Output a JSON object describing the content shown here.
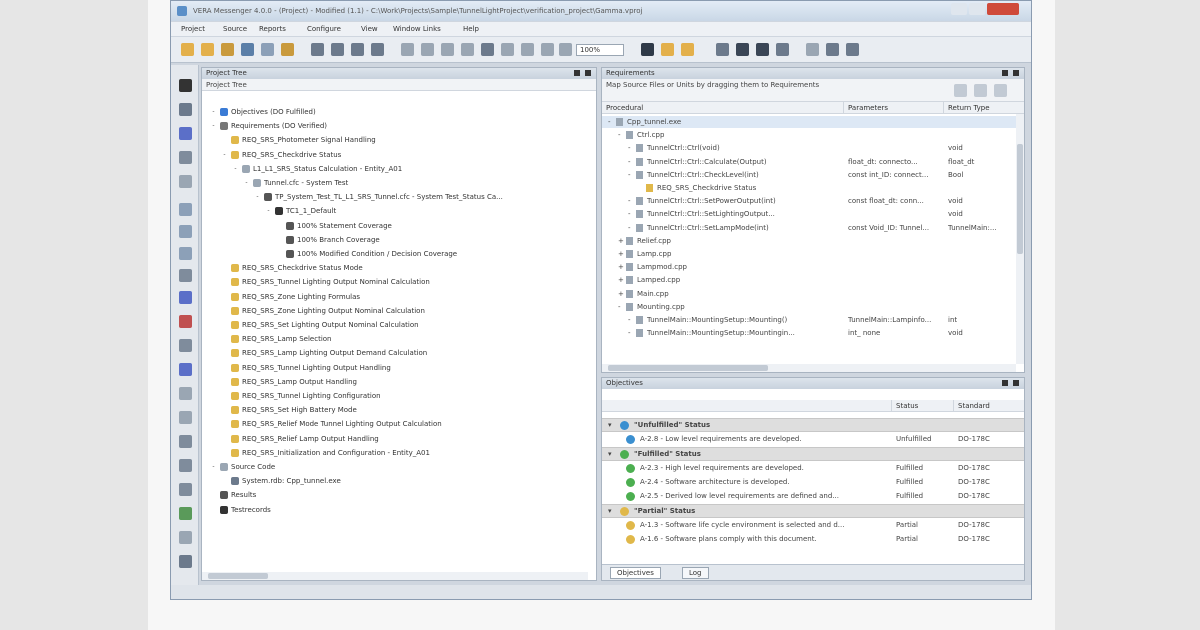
{
  "window": {
    "title": "VERA Messenger 4.0.0 - (Project) - Modified (1.1) - C:\\Work\\Projects\\Sample\\TunnelLightProject\\verification_project\\Gamma.vproj"
  },
  "menu": [
    "Project",
    "Source",
    "Reports",
    "Configure",
    "View",
    "Window Links",
    "Help"
  ],
  "toolbar": {
    "zoom_value": "100%"
  },
  "project_tree": {
    "header": "Project Tree",
    "subheader": "Project Tree",
    "rows": [
      {
        "label": "Objectives (DO Fulfilled)",
        "depth": 1,
        "toggle": "-",
        "icon": "#3a7bd5"
      },
      {
        "label": "Requirements (DO Verified)",
        "depth": 1,
        "toggle": "-",
        "icon": "#777777"
      },
      {
        "label": "REQ_SRS_Photometer Signal Handling",
        "depth": 2,
        "toggle": "",
        "icon": "#e0b84a"
      },
      {
        "label": "REQ_SRS_Checkdrive Status",
        "depth": 2,
        "toggle": "-",
        "icon": "#e0b84a"
      },
      {
        "label": "L1_L1_SRS_Status Calculation - Entity_A01",
        "depth": 3,
        "toggle": "-",
        "icon": "#9aa6b3"
      },
      {
        "label": "Tunnel.cfc - System Test",
        "depth": 4,
        "toggle": "-",
        "icon": "#9aa6b3"
      },
      {
        "label": "TP_System_Test_TL_L1_SRS_Tunnel.cfc - System Test_Status Ca...",
        "depth": 5,
        "toggle": "-",
        "icon": "#555555"
      },
      {
        "label": "TC1_1_Default",
        "depth": 6,
        "toggle": "-",
        "icon": "#333333"
      },
      {
        "label": "100% Statement Coverage",
        "depth": 7,
        "toggle": "",
        "icon": "#555555"
      },
      {
        "label": "100% Branch Coverage",
        "depth": 7,
        "toggle": "",
        "icon": "#555555"
      },
      {
        "label": "100% Modified Condition / Decision Coverage",
        "depth": 7,
        "toggle": "",
        "icon": "#555555"
      },
      {
        "label": "REQ_SRS_Checkdrive Status Mode",
        "depth": 2,
        "toggle": "",
        "icon": "#e0b84a"
      },
      {
        "label": "REQ_SRS_Tunnel Lighting Output Nominal Calculation",
        "depth": 2,
        "toggle": "",
        "icon": "#e0b84a"
      },
      {
        "label": "REQ_SRS_Zone Lighting Formulas",
        "depth": 2,
        "toggle": "",
        "icon": "#e0b84a"
      },
      {
        "label": "REQ_SRS_Zone Lighting Output Nominal Calculation",
        "depth": 2,
        "toggle": "",
        "icon": "#e0b84a"
      },
      {
        "label": "REQ_SRS_Set Lighting Output Nominal Calculation",
        "depth": 2,
        "toggle": "",
        "icon": "#e0b84a"
      },
      {
        "label": "REQ_SRS_Lamp Selection",
        "depth": 2,
        "toggle": "",
        "icon": "#e0b84a"
      },
      {
        "label": "REQ_SRS_Lamp Lighting Output Demand Calculation",
        "depth": 2,
        "toggle": "",
        "icon": "#e0b84a"
      },
      {
        "label": "REQ_SRS_Tunnel Lighting Output Handling",
        "depth": 2,
        "toggle": "",
        "icon": "#e0b84a"
      },
      {
        "label": "REQ_SRS_Lamp Output Handling",
        "depth": 2,
        "toggle": "",
        "icon": "#e0b84a"
      },
      {
        "label": "REQ_SRS_Tunnel Lighting Configuration",
        "depth": 2,
        "toggle": "",
        "icon": "#e0b84a"
      },
      {
        "label": "REQ_SRS_Set High Battery Mode",
        "depth": 2,
        "toggle": "",
        "icon": "#e0b84a"
      },
      {
        "label": "REQ_SRS_Relief Mode Tunnel Lighting Output Calculation",
        "depth": 2,
        "toggle": "",
        "icon": "#e0b84a"
      },
      {
        "label": "REQ_SRS_Relief Lamp Output Handling",
        "depth": 2,
        "toggle": "",
        "icon": "#e0b84a"
      },
      {
        "label": "REQ_SRS_Initialization and Configuration - Entity_A01",
        "depth": 2,
        "toggle": "",
        "icon": "#e0b84a"
      },
      {
        "label": "Source Code",
        "depth": 1,
        "toggle": "-",
        "icon": "#9aa6b3"
      },
      {
        "label": "System.rdb: Cpp_tunnel.exe",
        "depth": 2,
        "toggle": "",
        "icon": "#6c7a8c"
      },
      {
        "label": "Results",
        "depth": 1,
        "toggle": "",
        "icon": "#555555"
      },
      {
        "label": "Testrecords",
        "depth": 1,
        "toggle": "",
        "icon": "#333333"
      }
    ]
  },
  "requirements_panel": {
    "header": "Requirements",
    "hint": "Map Source Files or Units by dragging them to Requirements",
    "columns": [
      "Procedural",
      "Parameters",
      "Return Type"
    ],
    "rows": [
      {
        "depth": 0,
        "toggle": "-",
        "name": "Cpp_tunnel.exe",
        "params": "",
        "ret": ""
      },
      {
        "depth": 1,
        "toggle": "-",
        "name": "Ctrl.cpp",
        "params": "",
        "ret": ""
      },
      {
        "depth": 2,
        "toggle": "-",
        "name": "TunnelCtrl::Ctrl(void)",
        "params": "",
        "ret": "void"
      },
      {
        "depth": 2,
        "toggle": "-",
        "name": "TunnelCtrl::Ctrl::Calculate(Output)",
        "params": "float_dt: connecto...",
        "ret": "float_dt"
      },
      {
        "depth": 2,
        "toggle": "-",
        "name": "TunnelCtrl::Ctrl::CheckLevel(int)",
        "params": "const int_ID: connect...",
        "ret": "Bool"
      },
      {
        "depth": 3,
        "toggle": "",
        "name": "REQ_SRS_Checkdrive Status",
        "params": "",
        "ret": ""
      },
      {
        "depth": 2,
        "toggle": "-",
        "name": "TunnelCtrl::Ctrl::SetPowerOutput(int)",
        "params": "const float_dt: conn...",
        "ret": "void"
      },
      {
        "depth": 2,
        "toggle": "-",
        "name": "TunnelCtrl::Ctrl::SetLightingOutput...",
        "params": "",
        "ret": "void"
      },
      {
        "depth": 2,
        "toggle": "-",
        "name": "TunnelCtrl::Ctrl::SetLampMode(int)",
        "params": "const Void_ID: Tunnel...",
        "ret": "TunnelMain:..."
      },
      {
        "depth": 1,
        "toggle": "+",
        "name": "Relief.cpp",
        "params": "",
        "ret": ""
      },
      {
        "depth": 1,
        "toggle": "+",
        "name": "Lamp.cpp",
        "params": "",
        "ret": ""
      },
      {
        "depth": 1,
        "toggle": "+",
        "name": "Lampmod.cpp",
        "params": "",
        "ret": ""
      },
      {
        "depth": 1,
        "toggle": "+",
        "name": "Lamped.cpp",
        "params": "",
        "ret": ""
      },
      {
        "depth": 1,
        "toggle": "+",
        "name": "Main.cpp",
        "params": "",
        "ret": ""
      },
      {
        "depth": 1,
        "toggle": "-",
        "name": "Mounting.cpp",
        "params": "",
        "ret": ""
      },
      {
        "depth": 2,
        "toggle": "-",
        "name": "TunnelMain::MountingSetup::Mounting()",
        "params": "TunnelMain::Lampinfo...",
        "ret": "int"
      },
      {
        "depth": 2,
        "toggle": "-",
        "name": "TunnelMain::MountingSetup::Mountingin...",
        "params": "int_ none",
        "ret": "void"
      }
    ]
  },
  "objectives_panel": {
    "header": "Objectives",
    "columns": [
      "Status",
      "Standard"
    ],
    "groups": [
      {
        "label": "\"Unfulfilled\" Status",
        "color": "#3a8fd0",
        "rows": [
          {
            "text": "A-2.8 - Low level requirements are developed.",
            "status": "Unfulfilled",
            "standard": "DO-178C"
          }
        ]
      },
      {
        "label": "\"Fulfilled\" Status",
        "color": "#4caf50",
        "rows": [
          {
            "text": "A-2.3 - High level requirements are developed.",
            "status": "Fulfilled",
            "standard": "DO-178C"
          },
          {
            "text": "A-2.4 - Software architecture is developed.",
            "status": "Fulfilled",
            "standard": "DO-178C"
          },
          {
            "text": "A-2.5 - Derived low level requirements are defined and...",
            "status": "Fulfilled",
            "standard": "DO-178C"
          }
        ]
      },
      {
        "label": "\"Partial\" Status",
        "color": "#e0b84a",
        "rows": [
          {
            "text": "A-1.3 - Software life cycle environment is selected and d...",
            "status": "Partial",
            "standard": "DO-178C"
          },
          {
            "text": "A-1.6 - Software plans comply with this document.",
            "status": "Partial",
            "standard": "DO-178C"
          }
        ]
      }
    ],
    "tabs": [
      "Objectives",
      "Log"
    ]
  }
}
